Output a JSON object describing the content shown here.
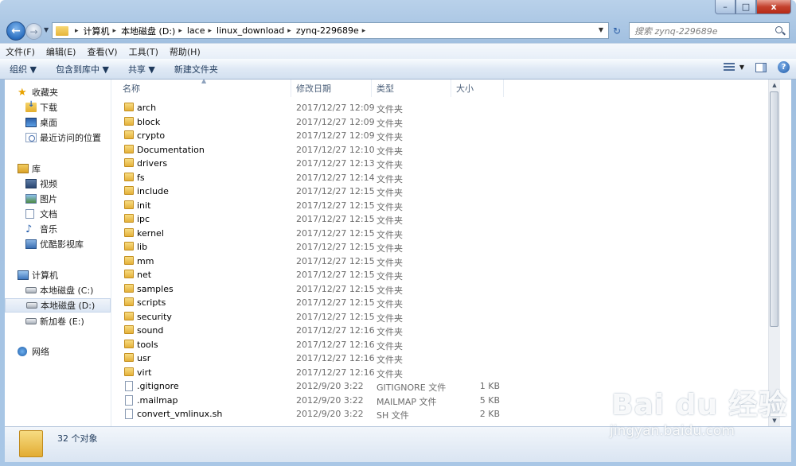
{
  "window": {
    "min": "–",
    "max": "□",
    "close": "x"
  },
  "nav": {
    "back": "←",
    "forward": "→",
    "history": "▼"
  },
  "address": {
    "crumbs": [
      "计算机",
      "本地磁盘 (D:)",
      "lace",
      "linux_download",
      "zynq-229689e"
    ],
    "separator": "▸",
    "dropdown": "▼",
    "refresh": "↻"
  },
  "search": {
    "placeholder": "搜索 zynq-229689e"
  },
  "menu": [
    "文件(F)",
    "编辑(E)",
    "查看(V)",
    "工具(T)",
    "帮助(H)"
  ],
  "toolbar": [
    "组织 ▼",
    "包含到库中 ▼",
    "共享 ▼",
    "新建文件夹"
  ],
  "toolbar_right": {
    "view_drop": "▼",
    "help": "?"
  },
  "sidebar": {
    "favorites": {
      "label": "收藏夹",
      "items": [
        "下载",
        "桌面",
        "最近访问的位置"
      ]
    },
    "libraries": {
      "label": "库",
      "items": [
        "视频",
        "图片",
        "文档",
        "音乐",
        "优酷影视库"
      ]
    },
    "computer": {
      "label": "计算机",
      "items": [
        "本地磁盘 (C:)",
        "本地磁盘 (D:)",
        "新加卷 (E:)"
      ]
    },
    "network": {
      "label": "网络"
    }
  },
  "columns": [
    "名称",
    "修改日期",
    "类型",
    "大小"
  ],
  "files": [
    {
      "name": "arch",
      "date": "2017/12/27 12:09",
      "type": "文件夹",
      "size": "",
      "kind": "folder"
    },
    {
      "name": "block",
      "date": "2017/12/27 12:09",
      "type": "文件夹",
      "size": "",
      "kind": "folder"
    },
    {
      "name": "crypto",
      "date": "2017/12/27 12:09",
      "type": "文件夹",
      "size": "",
      "kind": "folder"
    },
    {
      "name": "Documentation",
      "date": "2017/12/27 12:10",
      "type": "文件夹",
      "size": "",
      "kind": "folder"
    },
    {
      "name": "drivers",
      "date": "2017/12/27 12:13",
      "type": "文件夹",
      "size": "",
      "kind": "folder"
    },
    {
      "name": "fs",
      "date": "2017/12/27 12:14",
      "type": "文件夹",
      "size": "",
      "kind": "folder"
    },
    {
      "name": "include",
      "date": "2017/12/27 12:15",
      "type": "文件夹",
      "size": "",
      "kind": "folder"
    },
    {
      "name": "init",
      "date": "2017/12/27 12:15",
      "type": "文件夹",
      "size": "",
      "kind": "folder"
    },
    {
      "name": "ipc",
      "date": "2017/12/27 12:15",
      "type": "文件夹",
      "size": "",
      "kind": "folder"
    },
    {
      "name": "kernel",
      "date": "2017/12/27 12:15",
      "type": "文件夹",
      "size": "",
      "kind": "folder"
    },
    {
      "name": "lib",
      "date": "2017/12/27 12:15",
      "type": "文件夹",
      "size": "",
      "kind": "folder"
    },
    {
      "name": "mm",
      "date": "2017/12/27 12:15",
      "type": "文件夹",
      "size": "",
      "kind": "folder"
    },
    {
      "name": "net",
      "date": "2017/12/27 12:15",
      "type": "文件夹",
      "size": "",
      "kind": "folder"
    },
    {
      "name": "samples",
      "date": "2017/12/27 12:15",
      "type": "文件夹",
      "size": "",
      "kind": "folder"
    },
    {
      "name": "scripts",
      "date": "2017/12/27 12:15",
      "type": "文件夹",
      "size": "",
      "kind": "folder"
    },
    {
      "name": "security",
      "date": "2017/12/27 12:15",
      "type": "文件夹",
      "size": "",
      "kind": "folder"
    },
    {
      "name": "sound",
      "date": "2017/12/27 12:16",
      "type": "文件夹",
      "size": "",
      "kind": "folder"
    },
    {
      "name": "tools",
      "date": "2017/12/27 12:16",
      "type": "文件夹",
      "size": "",
      "kind": "folder"
    },
    {
      "name": "usr",
      "date": "2017/12/27 12:16",
      "type": "文件夹",
      "size": "",
      "kind": "folder"
    },
    {
      "name": "virt",
      "date": "2017/12/27 12:16",
      "type": "文件夹",
      "size": "",
      "kind": "folder"
    },
    {
      "name": ".gitignore",
      "date": "2012/9/20 3:22",
      "type": "GITIGNORE 文件",
      "size": "1 KB",
      "kind": "file"
    },
    {
      "name": ".mailmap",
      "date": "2012/9/20 3:22",
      "type": "MAILMAP 文件",
      "size": "5 KB",
      "kind": "file"
    },
    {
      "name": "convert_vmlinux.sh",
      "date": "2012/9/20 3:22",
      "type": "SH 文件",
      "size": "2 KB",
      "kind": "file"
    }
  ],
  "status": {
    "count": "32 个对象"
  },
  "watermark": {
    "main": "Bai du 经验",
    "sub": "jingyan.baidu.com"
  },
  "scroll": {
    "up": "▲",
    "down": "▼"
  }
}
